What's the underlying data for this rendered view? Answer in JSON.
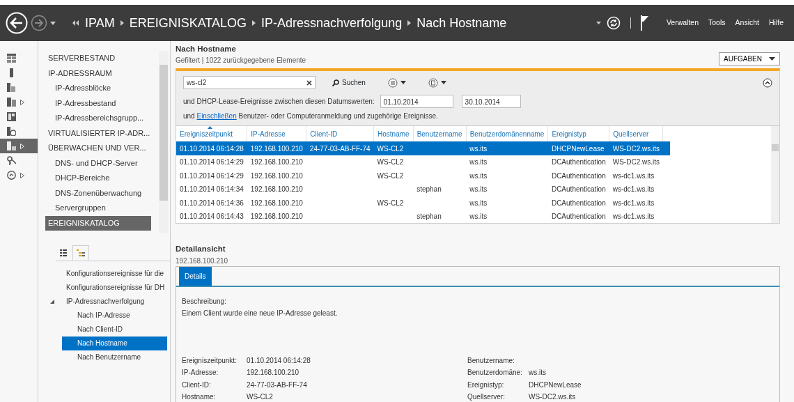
{
  "toolbar": {
    "breadcrumb": [
      "IPAM",
      "EREIGNISKATALOG",
      "IP-Adressnachverfolgung",
      "Nach Hostname"
    ],
    "menu": [
      "Verwalten",
      "Tools",
      "Ansicht",
      "Hilfe"
    ]
  },
  "rail": [
    {
      "kind": "grid",
      "expandable": false,
      "selected": false
    },
    {
      "kind": "server",
      "expandable": false,
      "selected": false
    },
    {
      "kind": "servers",
      "expandable": false,
      "selected": false
    },
    {
      "kind": "stack",
      "expandable": true,
      "selected": false
    },
    {
      "kind": "panes",
      "expandable": false,
      "selected": false
    },
    {
      "kind": "monitor",
      "expandable": false,
      "selected": false
    },
    {
      "kind": "events",
      "expandable": true,
      "selected": true
    },
    {
      "kind": "key",
      "expandable": false,
      "selected": false
    },
    {
      "kind": "dial",
      "expandable": true,
      "selected": false
    }
  ],
  "nav": [
    {
      "label": "SERVERBESTAND",
      "selected": false
    },
    {
      "label": "IP-ADRESSRAUM",
      "selected": false,
      "children": [
        {
          "label": "IP-Adressblöcke",
          "selected": false
        },
        {
          "label": "IP-Adressbestand",
          "selected": false
        },
        {
          "label": "IP-Adressbereichsgrupp...",
          "selected": false
        }
      ]
    },
    {
      "label": "VIRTUALISIERTER IP-ADR...",
      "selected": false
    },
    {
      "label": "ÜBERWACHEN UND VER...",
      "selected": false,
      "children": [
        {
          "label": "DNS- und DHCP-Server",
          "selected": false
        },
        {
          "label": "DHCP-Bereiche",
          "selected": false
        },
        {
          "label": "DNS-Zonenüberwachung",
          "selected": false
        },
        {
          "label": "Servergruppen",
          "selected": false
        }
      ]
    },
    {
      "label": "EREIGNISKATALOG",
      "selected": true
    }
  ],
  "tree_tabs": [
    {
      "kind": "list",
      "selected": false
    },
    {
      "kind": "tree",
      "selected": true
    }
  ],
  "tree": [
    {
      "label": "Konfigurationsereignisse für die",
      "selected": false
    },
    {
      "label": "Konfigurationsereignisse für DH",
      "selected": false
    },
    {
      "label": "IP-Adressnachverfolgung",
      "selected": false,
      "expanded": true,
      "children": [
        {
          "label": "Nach IP-Adresse",
          "selected": false
        },
        {
          "label": "Nach Client-ID",
          "selected": false
        },
        {
          "label": "Nach Hostname",
          "selected": true
        },
        {
          "label": "Nach Benutzername",
          "selected": false
        }
      ]
    }
  ],
  "header": {
    "title": "Nach Hostname",
    "subtitle": "Gefiltert | 1022 zurückgegebene  Elemente",
    "tasks": "AUFGABEN"
  },
  "filter": {
    "search_value": "ws-cl2",
    "search_button": "Suchen",
    "date_label": "und DHCP-Lease-Ereignisse zwischen diesen Datumswerten:",
    "date_from": "01.10.2014",
    "date_to": "30.10.2014",
    "include_prefix": "und",
    "include_link": "Einschließen",
    "include_suffix": "Benutzer- oder Computeranmeldung und zugehörige Ereignisse."
  },
  "table": {
    "columns": [
      {
        "label": "Ereigniszeitpunkt",
        "sorted": true
      },
      {
        "label": "IP-Adresse",
        "sorted": false
      },
      {
        "label": "Client-ID",
        "sorted": false
      },
      {
        "label": "Hostname",
        "sorted": false
      },
      {
        "label": "Benutzername",
        "sorted": false
      },
      {
        "label": "Benutzerdomänenname",
        "sorted": false
      },
      {
        "label": "Ereignistyp",
        "sorted": false
      },
      {
        "label": "Quellserver",
        "sorted": false
      }
    ],
    "rows": [
      {
        "selected": true,
        "cells": [
          "01.10.2014 06:14:28",
          "192.168.100.210",
          "24-77-03-AB-FF-74",
          "WS-CL2",
          "",
          "ws.its",
          "DHCPNewLease",
          "WS-DC2.ws.its"
        ]
      },
      {
        "selected": false,
        "cells": [
          "01.10.2014 06:14:29",
          "192.168.100.210",
          "",
          "WS-CL2",
          "",
          "ws.its",
          "DCAuthentication",
          "WS-DC2.ws.its"
        ]
      },
      {
        "selected": false,
        "cells": [
          "01.10.2014 06:14:29",
          "192.168.100.210",
          "",
          "WS-CL2",
          "",
          "ws.its",
          "DCAuthentication",
          "ws-dc1.ws.its"
        ]
      },
      {
        "selected": false,
        "cells": [
          "01.10.2014 06:14:34",
          "192.168.100.210",
          "",
          "",
          "stephan",
          "ws.its",
          "DCAuthentication",
          "ws-dc1.ws.its"
        ]
      },
      {
        "selected": false,
        "cells": [
          "01.10.2014 06:14:36",
          "192.168.100.210",
          "",
          "WS-CL2",
          "",
          "ws.its",
          "DCAuthentication",
          "ws-dc1.ws.its"
        ]
      },
      {
        "selected": false,
        "cells": [
          "01.10.2014 06:14:43",
          "192.168.100.210",
          "",
          "",
          "stephan",
          "ws.its",
          "DCAuthentication",
          "ws-dc1.ws.its"
        ]
      }
    ]
  },
  "detail": {
    "title": "Detailansicht",
    "subtitle": "192.168.100.210",
    "tabs": [
      {
        "label": "Details",
        "selected": true
      }
    ],
    "description_label": "Beschreibung:",
    "description": "Einem Client wurde eine neue IP-Adresse geleast.",
    "fields_left": [
      {
        "label": "Ereigniszeitpunkt:",
        "value": "01.10.2014 06:14:28"
      },
      {
        "label": "IP-Adresse:",
        "value": "192.168.100.210"
      },
      {
        "label": "Client-ID:",
        "value": "24-77-03-AB-FF-74"
      },
      {
        "label": "Hostname:",
        "value": "WS-CL2"
      }
    ],
    "fields_right": [
      {
        "label": "Benutzername:"
      },
      {
        "label": "Benutzerdomäne:",
        "value": "ws.its"
      },
      {
        "label": "Ereignistyp:",
        "value": "DHCPNewLease"
      },
      {
        "label": "Quellserver:",
        "value": "WS-DC2.ws.its"
      }
    ]
  }
}
